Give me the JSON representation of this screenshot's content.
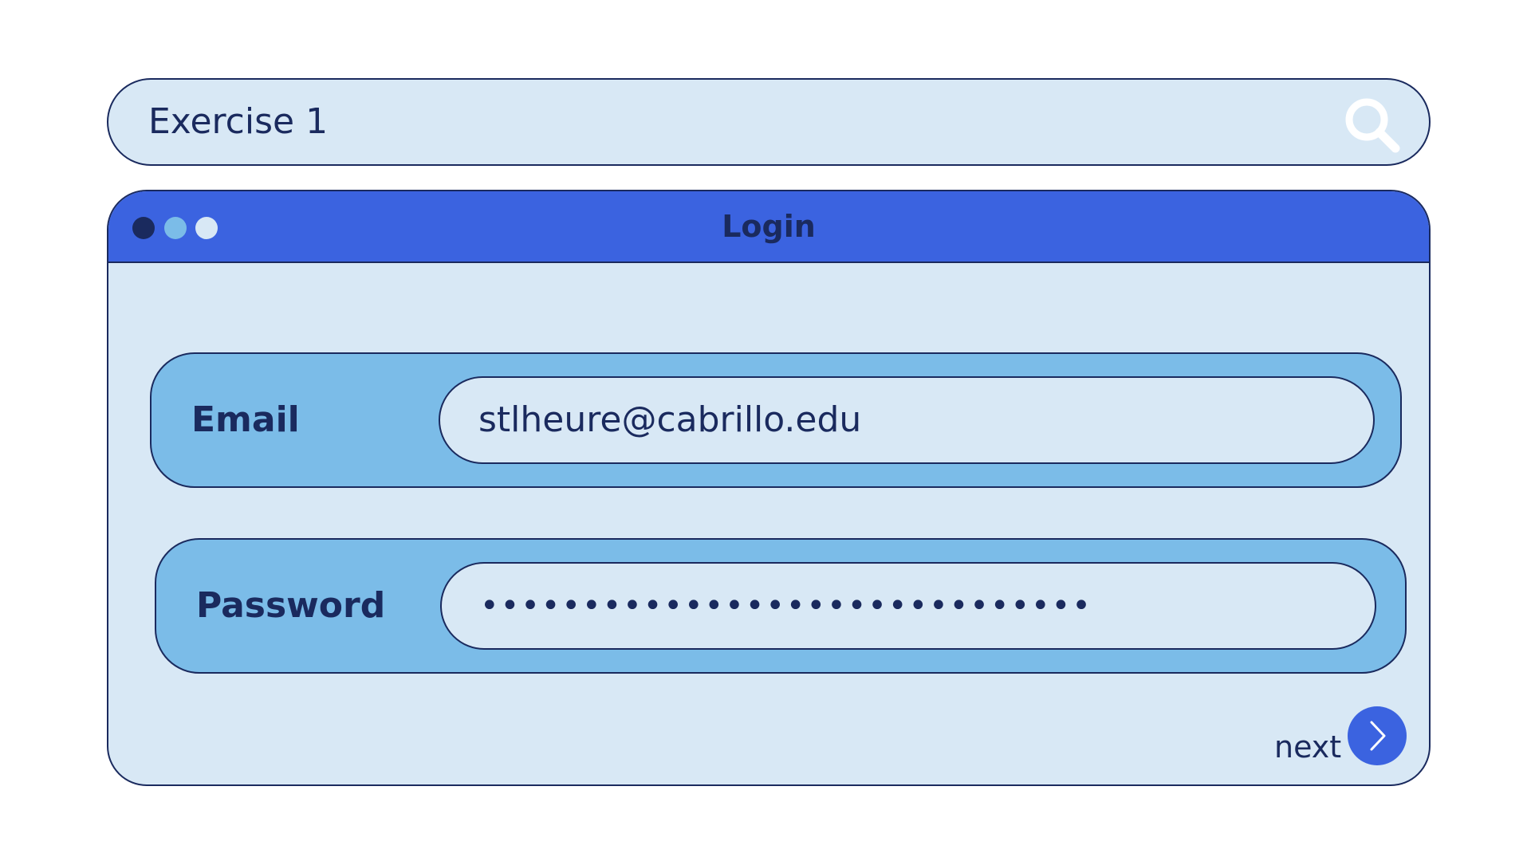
{
  "search": {
    "value": "Exercise 1",
    "icon": "search-icon"
  },
  "window": {
    "title": "Login",
    "controls": [
      {
        "name": "close",
        "color": "#1a2a5e"
      },
      {
        "name": "minimize",
        "color": "#7bbce8"
      },
      {
        "name": "maximize",
        "color": "#d8e8f5"
      }
    ]
  },
  "form": {
    "email": {
      "label": "Email",
      "value": "stlheure@cabrillo.edu"
    },
    "password": {
      "label": "Password",
      "masked_value": "••••••••••••••••••••••••••••••"
    },
    "next_label": "next",
    "next_icon": "chevron-right-icon"
  },
  "colors": {
    "titlebar": "#3b63e0",
    "panel": "#d8e8f5",
    "field_row": "#7bbce8",
    "text": "#1a2a5e"
  }
}
